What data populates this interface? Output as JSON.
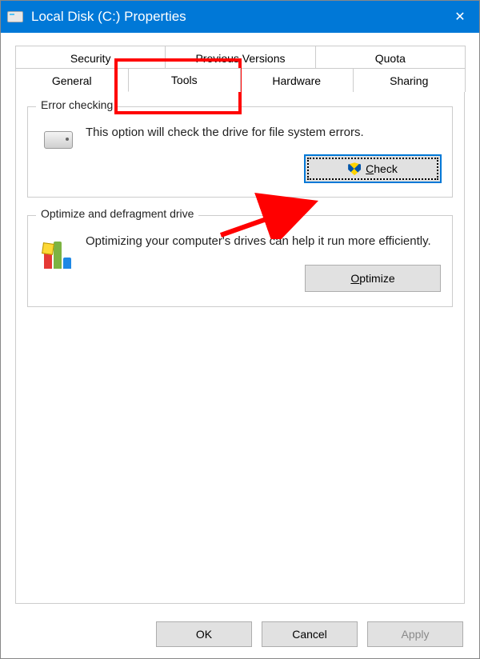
{
  "window": {
    "title": "Local Disk (C:) Properties"
  },
  "tabs": {
    "row1": [
      "Security",
      "Previous Versions",
      "Quota"
    ],
    "row2": [
      "General",
      "Tools",
      "Hardware",
      "Sharing"
    ],
    "active": "Tools"
  },
  "groups": {
    "error_checking": {
      "legend": "Error checking",
      "text": "This option will check the drive for file system errors.",
      "button": "Check"
    },
    "optimize": {
      "legend": "Optimize and defragment drive",
      "text": "Optimizing your computer's drives can help it run more efficiently.",
      "button": "Optimize"
    }
  },
  "footer": {
    "ok": "OK",
    "cancel": "Cancel",
    "apply": "Apply"
  },
  "annotations": {
    "highlight_tools_tab": true,
    "arrow_to_check": true
  }
}
